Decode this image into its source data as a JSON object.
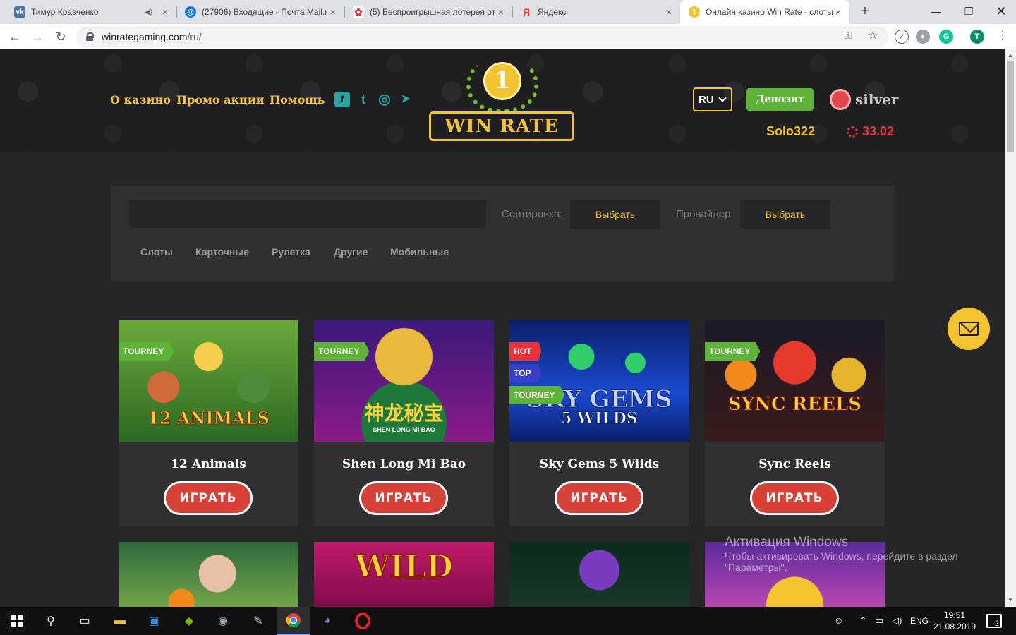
{
  "browser": {
    "tabs": [
      {
        "title": "Тимур Кравченко",
        "favicon": "vk-icon",
        "color": "#4a76a8",
        "glyph": "vk"
      },
      {
        "title": "(27906) Входящие - Почта Mail.r",
        "favicon": "mail-icon",
        "color": "#1a73e8",
        "glyph": "@"
      },
      {
        "title": "(5) Беспроигрышная лотерея от",
        "favicon": "lottery-icon",
        "color": "#e6343a",
        "glyph": "✿"
      },
      {
        "title": "Яндекс",
        "favicon": "yandex-icon",
        "color": "#ffffff",
        "glyph": "Я"
      },
      {
        "title": "Онлайн казино Win Rate - слоты",
        "favicon": "winrate-icon",
        "color": "#f4c430",
        "glyph": "1"
      }
    ],
    "url": {
      "host": "winrategaming.com",
      "path": "/ru/"
    },
    "profile_initial": "T"
  },
  "site": {
    "nav": {
      "about": "О казино",
      "promo": "Промо акции",
      "help": "Помощь"
    },
    "social": {
      "facebook": "f",
      "twitter": "t",
      "instagram": "◎",
      "telegram": "➤"
    },
    "logo": {
      "medal": "1",
      "text": "WIN RATE"
    },
    "lang": "RU",
    "deposit": "Депозит",
    "status": "silver",
    "username": "Solo322",
    "balance": "33.02",
    "filters": {
      "sort_label": "Сортировка:",
      "sort_value": "Выбрать",
      "provider_label": "Провайдер:",
      "provider_value": "Выбрать",
      "categories": [
        "Слоты",
        "Карточные",
        "Рулетка",
        "Другие",
        "Мобильные"
      ]
    },
    "games": [
      {
        "name": "12 Animals",
        "art_title": "12 ANIMALS",
        "badges": [
          "TOURNEY"
        ]
      },
      {
        "name": "Shen Long Mi Bao",
        "art_title": "神龙秘宝",
        "art_sub": "SHEN LONG MI BAO",
        "badges": [
          "TOURNEY"
        ]
      },
      {
        "name": "Sky Gems 5 Wilds",
        "art_title": "SKY GEMS",
        "art_sub": "5 WILDS",
        "badges": [
          "HOT",
          "TOP",
          "TOURNEY"
        ]
      },
      {
        "name": "Sync Reels",
        "art_title": "SYNC REELS",
        "badges": [
          "TOURNEY"
        ]
      }
    ],
    "play_label": "ИГРАТЬ",
    "row2_art": [
      "",
      "WILD",
      "",
      ""
    ]
  },
  "watermark": {
    "title": "Активация Windows",
    "subtitle": "Чтобы активировать Windows, перейдите в раздел",
    "subtitle2": "\"Параметры\"."
  },
  "taskbar": {
    "lang": "ENG",
    "time": "19:51",
    "date": "21.08.2019",
    "notifications": "2"
  }
}
